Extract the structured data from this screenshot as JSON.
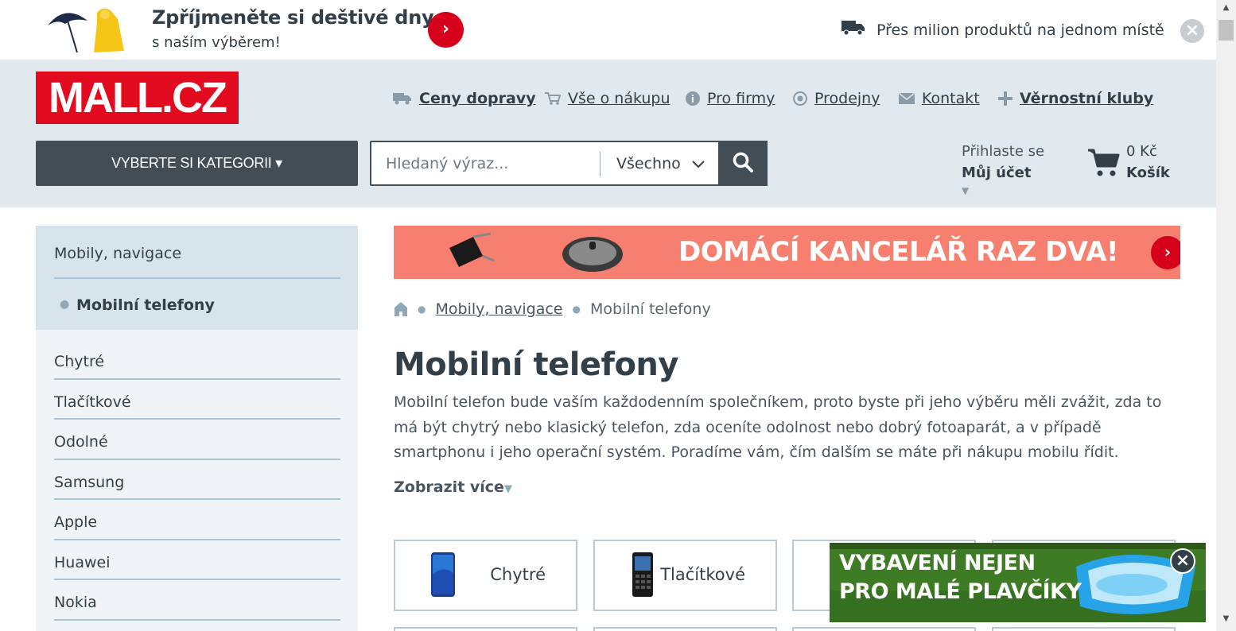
{
  "promo": {
    "title": "Zpříjmeněte si deštivé dny",
    "subtitle": "s naším výběrem!",
    "arrow": "›",
    "claim": "Přes milion produktů na jednom místě",
    "close": "×",
    "image_icon": "umbrella-raincoat-icon"
  },
  "header": {
    "logo": "MALL.CZ",
    "nav": [
      {
        "label": "Ceny dopravy",
        "icon": "truck-icon"
      },
      {
        "label": "Vše o nákupu",
        "icon": "cart-small-icon"
      },
      {
        "label": "Pro firmy",
        "icon": "info-icon"
      },
      {
        "label": "Prodejny",
        "icon": "store-icon"
      },
      {
        "label": "Kontakt",
        "icon": "mail-icon"
      },
      {
        "label": "Věrnostní kluby",
        "icon": "plus-icon"
      }
    ],
    "category_button": "VYBERTE SI KATEGORII ▾",
    "search": {
      "placeholder": "Hledaný výraz...",
      "category": "Všechno"
    },
    "login": {
      "label": "Přihlaste se",
      "account": "Můj účet"
    },
    "cart": {
      "price": "0 Kč",
      "label": "Košík"
    }
  },
  "sidebar": {
    "parent": "Mobily, navigace",
    "current": "Mobilní telefony",
    "items": [
      "Chytré",
      "Tlačítkové",
      "Odolné",
      "Samsung",
      "Apple",
      "Huawei",
      "Nokia"
    ]
  },
  "banner": {
    "text": "DOMÁCÍ KANCELÁŘ RAZ DVA!",
    "arrow": "›"
  },
  "breadcrumb": {
    "home_icon": "home-icon",
    "items": [
      "Mobily, navigace",
      "Mobilní telefony"
    ]
  },
  "main": {
    "title": "Mobilní telefony",
    "description": "Mobilní telefon bude vaším každodenním společníkem, proto byste při jeho výběru měli zvážit, zda to má být chytrý nebo klasický telefon, zda oceníte odolnost nebo dobrý fotoaparát, a v případě smartphonu i jeho operační systém. Poradíme vám, čím dalším se máte při nákupu mobilu řídit.",
    "show_more": "Zobrazit více"
  },
  "category_cards": [
    {
      "label": "Chytré",
      "icon": "smartphone-icon"
    },
    {
      "label": "Tlačítkové",
      "icon": "feature-phone-icon"
    },
    {
      "label": "",
      "icon": ""
    }
  ],
  "popup_ad": {
    "line1": "VYBAVENÍ NEJEN",
    "line2": "PRO MALÉ PLAVČÍKY",
    "close": "×"
  },
  "colors": {
    "brand_red": "#e10a1e",
    "header_bg": "#e1e9ef",
    "dark": "#434d55",
    "banner_bg": "#f77f70"
  }
}
